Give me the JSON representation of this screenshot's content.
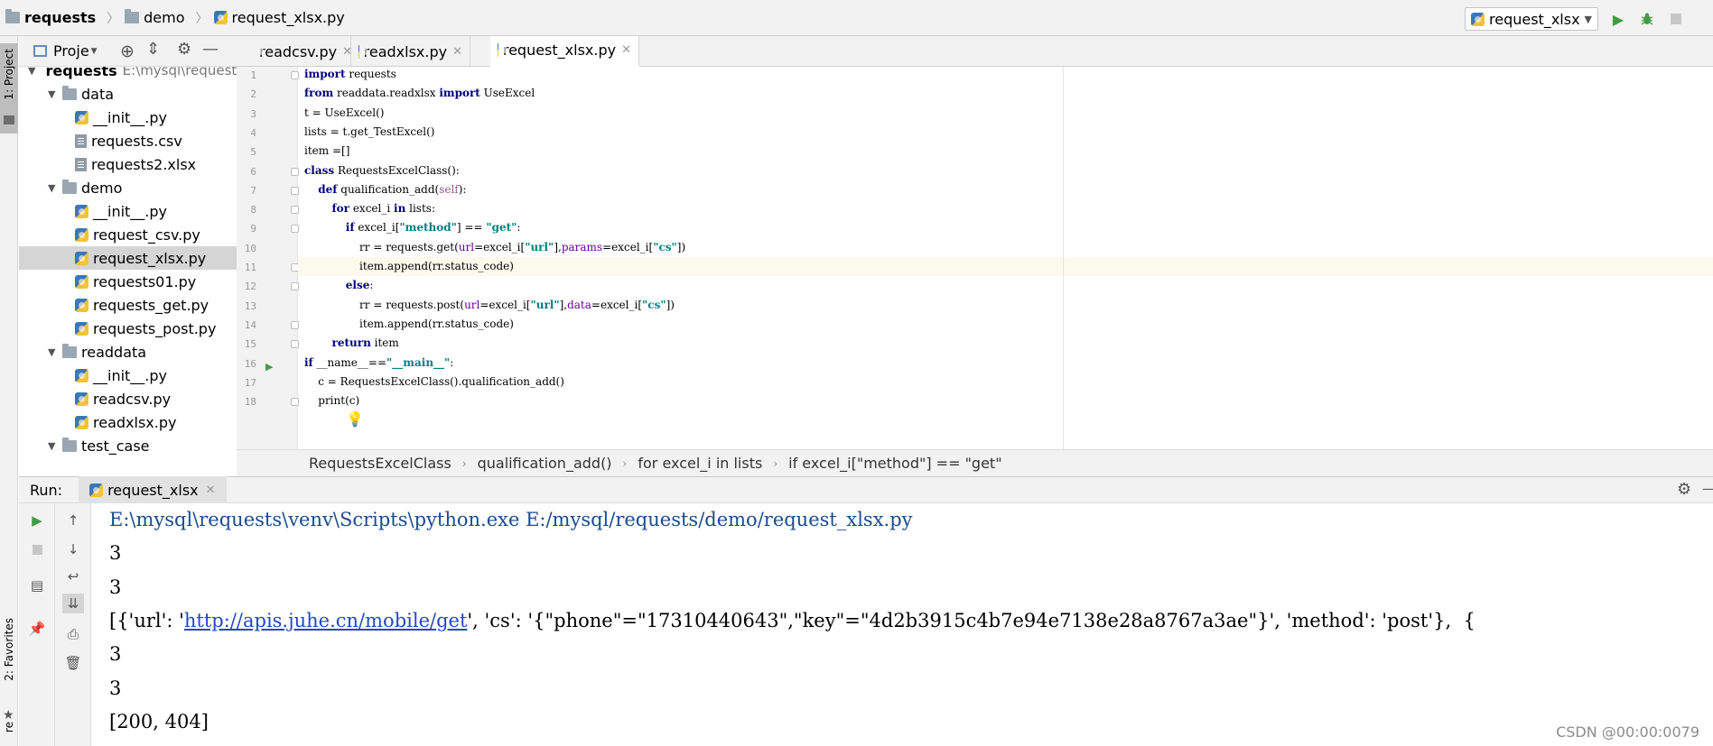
{
  "nav": {
    "breadcrumb": [
      "requests",
      "demo",
      "request_xlsx.py"
    ],
    "run_config": "request_xlsx"
  },
  "left_stripe": {
    "project_label": "1: Project",
    "favorites_label": "2: Favorites",
    "structure_label": "re"
  },
  "project_panel": {
    "title": "Proje",
    "tree": [
      {
        "label": "requests",
        "extra": "E:\\mysql\\requests",
        "kind": "folder",
        "depth": 0,
        "expanded": true,
        "bold": true
      },
      {
        "label": "data",
        "kind": "folder",
        "depth": 1,
        "expanded": true
      },
      {
        "label": "__init__.py",
        "kind": "py",
        "depth": 2
      },
      {
        "label": "requests.csv",
        "kind": "file",
        "depth": 2
      },
      {
        "label": "requests2.xlsx",
        "kind": "file",
        "depth": 2
      },
      {
        "label": "demo",
        "kind": "folder",
        "depth": 1,
        "expanded": true
      },
      {
        "label": "__init__.py",
        "kind": "py",
        "depth": 2
      },
      {
        "label": "request_csv.py",
        "kind": "py",
        "depth": 2
      },
      {
        "label": "request_xlsx.py",
        "kind": "py",
        "depth": 2,
        "selected": true
      },
      {
        "label": "requests01.py",
        "kind": "py",
        "depth": 2
      },
      {
        "label": "requests_get.py",
        "kind": "py",
        "depth": 2
      },
      {
        "label": "requests_post.py",
        "kind": "py",
        "depth": 2
      },
      {
        "label": "readdata",
        "kind": "folder",
        "depth": 1,
        "expanded": true
      },
      {
        "label": "__init__.py",
        "kind": "py",
        "depth": 2
      },
      {
        "label": "readcsv.py",
        "kind": "py",
        "depth": 2
      },
      {
        "label": "readxlsx.py",
        "kind": "py",
        "depth": 2
      },
      {
        "label": "test_case",
        "kind": "folder",
        "depth": 1,
        "expanded": true
      }
    ]
  },
  "editor": {
    "tabs": [
      {
        "label": "readcsv.py",
        "active": false
      },
      {
        "label": "readxlsx.py",
        "active": false
      },
      {
        "label": "request_xlsx.py",
        "active": true
      }
    ],
    "current_line": 11,
    "lines": [
      [
        {
          "t": "import",
          "c": "kw"
        },
        {
          "t": " requests"
        }
      ],
      [
        {
          "t": "from",
          "c": "kw"
        },
        {
          "t": " readdata.readxlsx "
        },
        {
          "t": "import",
          "c": "kw"
        },
        {
          "t": " UseExcel"
        }
      ],
      [
        {
          "t": "t = UseExcel()"
        }
      ],
      [
        {
          "t": "lists = t.get_TestExcel()"
        }
      ],
      [
        {
          "t": "item =[]"
        }
      ],
      [
        {
          "t": "class",
          "c": "kw"
        },
        {
          "t": " RequestsExcelClass():"
        }
      ],
      [
        {
          "t": "    "
        },
        {
          "t": "def",
          "c": "kw"
        },
        {
          "t": " qualification_add("
        },
        {
          "t": "self",
          "c": "slf"
        },
        {
          "t": "):"
        }
      ],
      [
        {
          "t": "        "
        },
        {
          "t": "for",
          "c": "kw"
        },
        {
          "t": " excel_i "
        },
        {
          "t": "in",
          "c": "kw"
        },
        {
          "t": " lists:"
        }
      ],
      [
        {
          "t": "            "
        },
        {
          "t": "if",
          "c": "kw"
        },
        {
          "t": " excel_i["
        },
        {
          "t": "\"method\"",
          "c": "str"
        },
        {
          "t": "] == "
        },
        {
          "t": "\"get\"",
          "c": "str"
        },
        {
          "t": ":"
        }
      ],
      [
        {
          "t": "                rr = requests.get("
        },
        {
          "t": "url",
          "c": "prm"
        },
        {
          "t": "=excel_i["
        },
        {
          "t": "\"url\"",
          "c": "str"
        },
        {
          "t": "],"
        },
        {
          "t": "params",
          "c": "prm"
        },
        {
          "t": "=excel_i["
        },
        {
          "t": "\"cs\"",
          "c": "str"
        },
        {
          "t": "])"
        }
      ],
      [
        {
          "t": "                item.append(rr.status_code)"
        }
      ],
      [
        {
          "t": "            "
        },
        {
          "t": "else",
          "c": "kw"
        },
        {
          "t": ":"
        }
      ],
      [
        {
          "t": "                rr = requests.post("
        },
        {
          "t": "url",
          "c": "prm"
        },
        {
          "t": "=excel_i["
        },
        {
          "t": "\"url\"",
          "c": "str"
        },
        {
          "t": "],"
        },
        {
          "t": "data",
          "c": "prm"
        },
        {
          "t": "=excel_i["
        },
        {
          "t": "\"cs\"",
          "c": "str"
        },
        {
          "t": "])"
        }
      ],
      [
        {
          "t": "                item.append(rr.status_code)"
        }
      ],
      [
        {
          "t": "        "
        },
        {
          "t": "return",
          "c": "kw"
        },
        {
          "t": " item"
        }
      ],
      [
        {
          "t": "if",
          "c": "kw"
        },
        {
          "t": " __name__=="
        },
        {
          "t": "\"__main__\"",
          "c": "str"
        },
        {
          "t": ":"
        }
      ],
      [
        {
          "t": "    c = RequestsExcelClass().qualification_add()"
        }
      ],
      [
        {
          "t": "    print(c)"
        }
      ]
    ],
    "breadcrumb": [
      "RequestsExcelClass",
      "qualification_add()",
      "for excel_i in lists",
      "if excel_i[\"method\"] == \"get\""
    ]
  },
  "run_panel": {
    "label": "Run:",
    "tab": "request_xlsx",
    "console": [
      {
        "parts": [
          {
            "t": "E:\\mysql\\requests\\venv\\Scripts\\python.exe E:/mysql/requests/demo/request_xlsx.py"
          }
        ],
        "c": "cmd"
      },
      {
        "parts": [
          {
            "t": "3"
          }
        ]
      },
      {
        "parts": [
          {
            "t": "3"
          }
        ]
      },
      {
        "parts": [
          {
            "t": "[{'url': '"
          },
          {
            "t": "http://apis.juhe.cn/mobile/get",
            "c": "link"
          },
          {
            "t": "', 'cs': '{\"phone\"=\"17310440643\",\"key\"=\"4d2b3915c4b7e94e7138e28a8767a3ae\"}', 'method': 'post'},  {"
          }
        ]
      },
      {
        "parts": [
          {
            "t": "3"
          }
        ]
      },
      {
        "parts": [
          {
            "t": "3"
          }
        ]
      },
      {
        "parts": [
          {
            "t": "[200, 404]"
          }
        ]
      }
    ]
  },
  "watermark": "CSDN @00:00:0079",
  "colors": {
    "accent_green": "#3f9e45",
    "keyword": "#000080",
    "string": "#008080",
    "param": "#660099",
    "link": "#2448c4",
    "command": "#1a4b8f"
  }
}
